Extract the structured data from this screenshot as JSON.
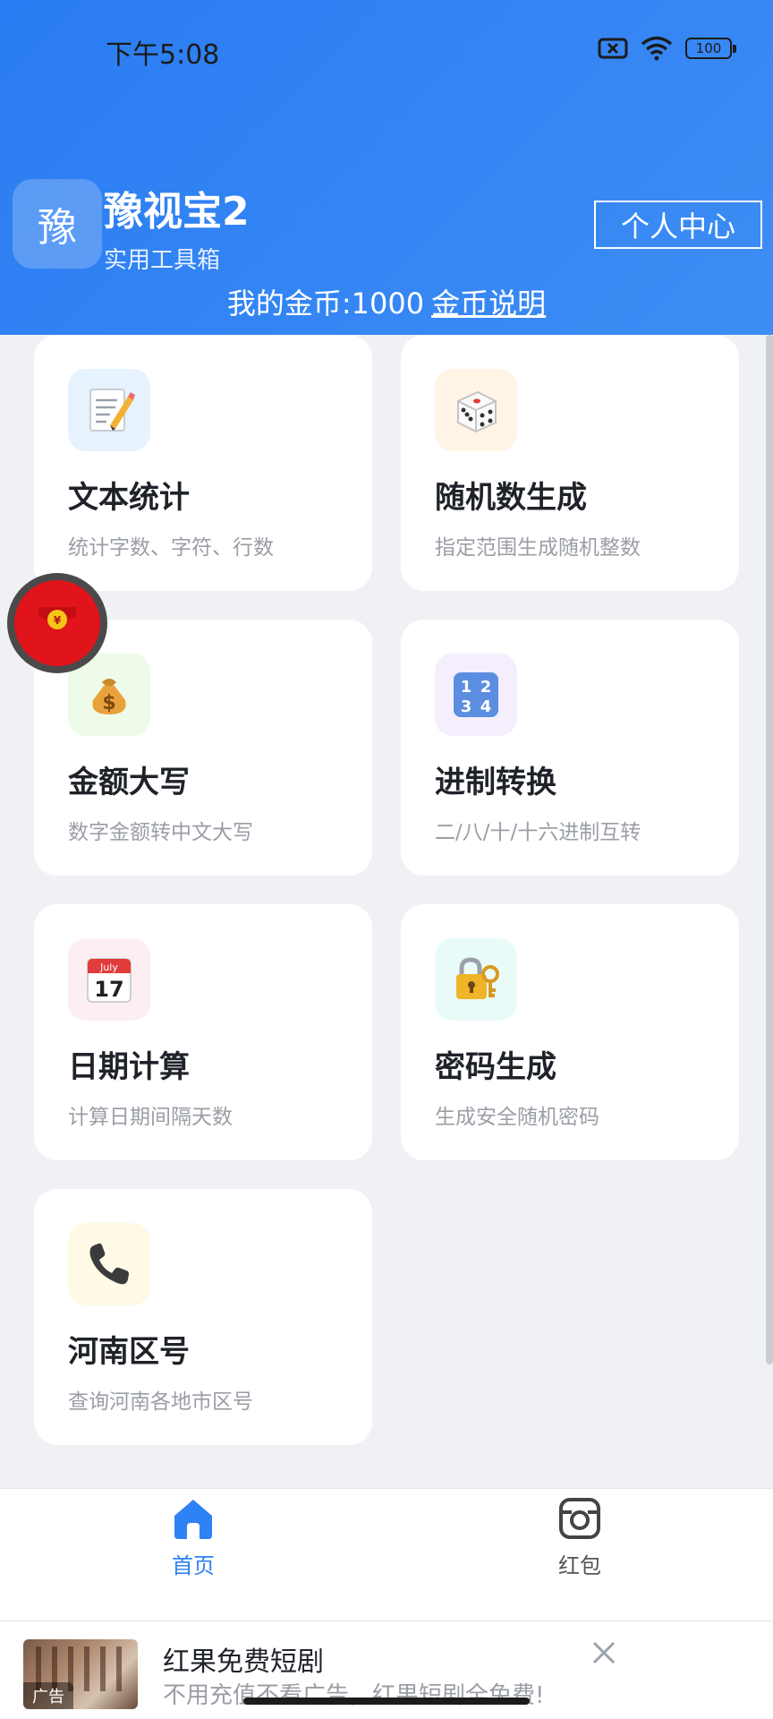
{
  "status_bar": {
    "time": "下午5:08",
    "battery": "100"
  },
  "header": {
    "avatar_char": "豫",
    "app_name": "豫视宝2",
    "subtitle": "实用工具箱",
    "profile_button": "个人中心",
    "coins_label": "我的金币:1000",
    "coins_link": "金币说明",
    "bg_color": "#2f82f3"
  },
  "tools": [
    {
      "title": "文本统计",
      "desc": "统计字数、字符、行数",
      "icon": "memo-icon",
      "icon_bg": "#e7f2ff"
    },
    {
      "title": "随机数生成",
      "desc": "指定范围生成随机整数",
      "icon": "dice-icon",
      "icon_bg": "#fff4e5"
    },
    {
      "title": "金额大写",
      "desc": "数字金额转中文大写",
      "icon": "money-bag-icon",
      "icon_bg": "#eefbe9"
    },
    {
      "title": "进制转换",
      "desc": "二/八/十/十六进制互转",
      "icon": "numbers-icon",
      "icon_bg": "#f4eefd"
    },
    {
      "title": "日期计算",
      "desc": "计算日期间隔天数",
      "icon": "calendar-icon",
      "icon_bg": "#fdeef1"
    },
    {
      "title": "密码生成",
      "desc": "生成安全随机密码",
      "icon": "lock-key-icon",
      "icon_bg": "#e8fbf8"
    },
    {
      "title": "河南区号",
      "desc": "查询河南各地市区号",
      "icon": "phone-icon",
      "icon_bg": "#fffae6"
    }
  ],
  "calendar_icon_text": {
    "month": "July",
    "day": "17"
  },
  "numbers_icon_text": [
    "1",
    "2",
    "3",
    "4"
  ],
  "bottom_nav": [
    {
      "label": "首页",
      "icon": "home-icon",
      "active": true
    },
    {
      "label": "红包",
      "icon": "camera-icon",
      "active": false
    }
  ],
  "ad": {
    "title": "红果免费短剧",
    "desc": "不用充值不看广告，红果短剧全免费!",
    "tag": "广告"
  },
  "colors": {
    "accent": "#2f82f3",
    "red_packet": "#e0141a"
  }
}
